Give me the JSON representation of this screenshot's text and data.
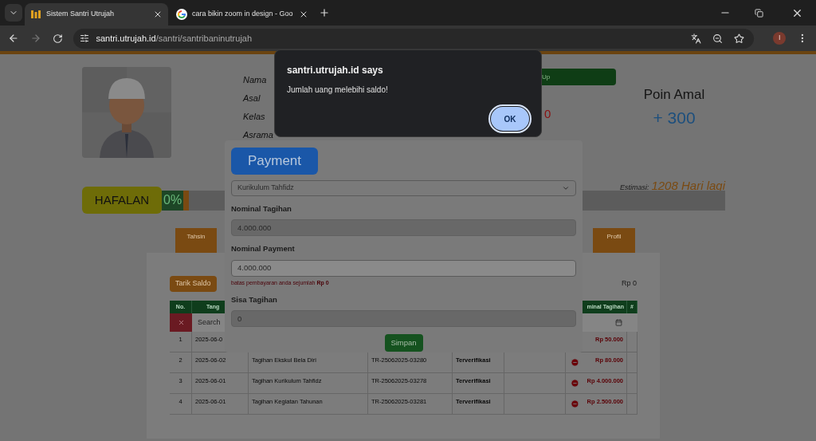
{
  "browser": {
    "tabs": [
      {
        "title": "Sistem Santri Utrujah",
        "selected": true,
        "kind": "site"
      },
      {
        "title": "cara bikin zoom in design - Goo",
        "selected": false,
        "kind": "google"
      }
    ],
    "url": {
      "domain": "santri.utrujah.id",
      "path": "/santri/santribaninutrujah"
    },
    "profile_initial": "I"
  },
  "profile": {
    "labels": [
      "Nama",
      "Asal",
      "Kelas",
      "Asrama"
    ],
    "status_button": "Up",
    "balance_digit": "0",
    "points_label": "Poin Amal",
    "points": "+ 300"
  },
  "hafalan": {
    "label": "HAFALAN",
    "percent": "0%",
    "level": 0.01,
    "estimate_label": "Estimasi:",
    "estimate": "1208 Hari lagi"
  },
  "menu_tabs": [
    "Tahsin",
    "Profil"
  ],
  "wallet": {
    "withdraw_button": "Tarik Saldo",
    "balance": "Rp 0"
  },
  "table": {
    "columns": [
      "No.",
      "Tang",
      "",
      "",
      "",
      "",
      "minal Tagihan",
      "#"
    ],
    "search_placeholder": "Search",
    "rows": [
      {
        "no": "1",
        "date": "2025-06-0",
        "amount": "Rp 50.000"
      },
      {
        "no": "2",
        "date": "2025-06-02",
        "description": "Tagihan Ekskul Bela Diri",
        "reference": "TR-25062025-03280",
        "status": "Terverifikasi",
        "amount": "Rp 80.000",
        "icon": true
      },
      {
        "no": "3",
        "date": "2025-06-01",
        "description": "Tagihan Kurikulum Tahfidz",
        "reference": "TR-25062025-03278",
        "status": "Terverifikasi",
        "amount": "Rp 4.000.000",
        "icon": true
      },
      {
        "no": "4",
        "date": "2025-06-01",
        "description": "Tagihan Kegiatan Tahunan",
        "reference": "TR-25062025-03281",
        "status": "Terverifikasi",
        "amount": "Rp 2.500.000",
        "icon": true
      }
    ]
  },
  "modal": {
    "title_button": "Payment",
    "select": "Kurikulum Tahfidz",
    "fields": [
      {
        "label": "Nominal Tagihan",
        "value": "4.000.000",
        "disabled": true
      },
      {
        "label": "Nominal Payment",
        "value": "4.000.000",
        "disabled": false,
        "hint": "batas pembayaran anda sejumlah **Rp 0**"
      },
      {
        "label": "Sisa Tagihan",
        "value": "0",
        "disabled": true
      }
    ],
    "save_button": "Simpan"
  },
  "alert": {
    "title": "santri.utrujah.id says",
    "message": "Jumlah uang melebihi saldo!",
    "ok_button": "OK"
  }
}
